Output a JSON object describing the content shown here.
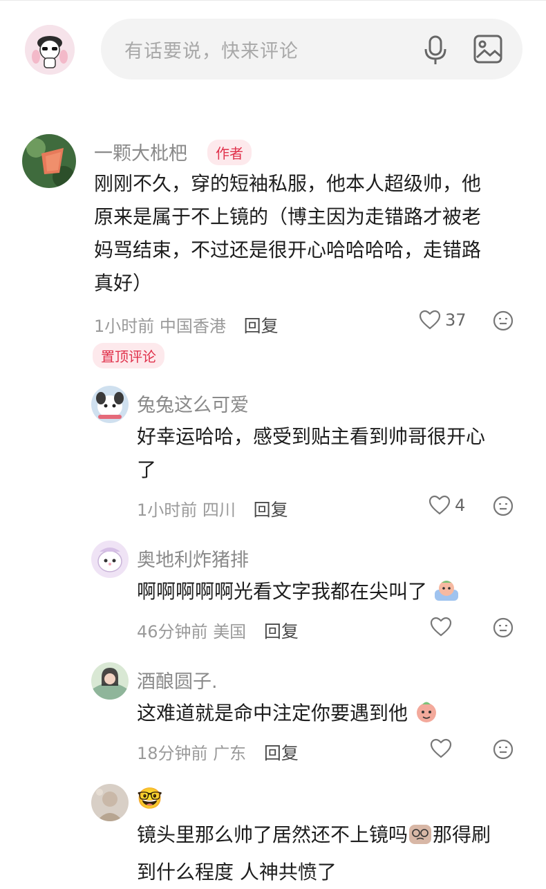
{
  "composer": {
    "placeholder": "有话要说，快来评论",
    "mic_icon": "mic-icon",
    "image_icon": "image-icon"
  },
  "comments": [
    {
      "user": "一颗大枇杷",
      "badge": "作者",
      "text_lines": [
        "刚刚不久，穿的短袖私服，他本人超级帅，他",
        "原来是属于不上镜的（博主因为走错路才被老",
        "妈骂结束，不过还是很开心哈哈哈哈，走错路",
        "真好）"
      ],
      "time": "1小时前",
      "location": "中国香港",
      "reply": "回复",
      "likes": "37",
      "pinned": "置顶评论"
    },
    {
      "user": "兔兔这么可爱",
      "text_lines": [
        "好幸运哈哈，感受到贴主看到帅哥很开心",
        "了"
      ],
      "time": "1小时前",
      "location": "四川",
      "reply": "回复",
      "likes": "4"
    },
    {
      "user": "奥地利炸猪排",
      "text_lines": [
        "啊啊啊啊啊光看文字我都在尖叫了"
      ],
      "time": "46分钟前",
      "location": "美国",
      "reply": "回复",
      "likes": ""
    },
    {
      "user": "酒酿圆子.",
      "text_lines": [
        "这难道就是命中注定你要遇到他"
      ],
      "time": "18分钟前",
      "location": "广东",
      "reply": "回复",
      "likes": ""
    },
    {
      "user": "🤓",
      "text_lines": [
        "镜头里那么帅了居然还不上镜吗",
        "到什么程度 人神共愤了"
      ],
      "text_line0_suffix": "那得刷"
    }
  ]
}
